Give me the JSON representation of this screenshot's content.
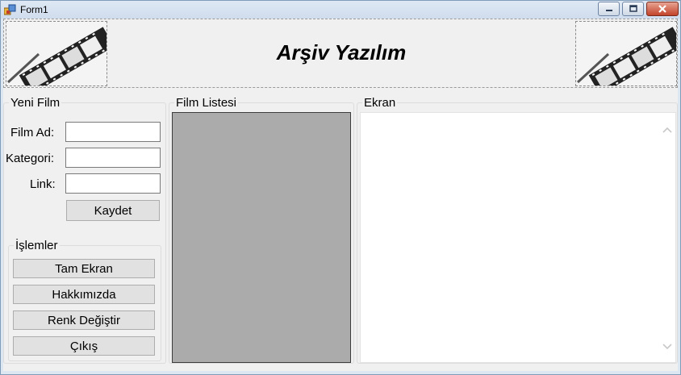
{
  "window": {
    "title": "Form1",
    "minimize_icon": "minimize-icon",
    "maximize_icon": "maximize-icon",
    "close_icon": "close-icon"
  },
  "banner": {
    "title": "Arşiv Yazılım",
    "left_image": "film-strip",
    "right_image": "film-strip"
  },
  "new_film": {
    "group_label": "Yeni Film",
    "name_label": "Film Ad:",
    "name_value": "",
    "category_label": "Kategori:",
    "category_value": "",
    "link_label": "Link:",
    "link_value": "",
    "save_label": "Kaydet"
  },
  "operations": {
    "group_label": "İşlemler",
    "buttons": [
      "Tam Ekran",
      "Hakkımızda",
      "Renk Değiştir",
      "Çıkış"
    ]
  },
  "film_list": {
    "group_label": "Film Listesi",
    "items": []
  },
  "screen": {
    "group_label": "Ekran"
  },
  "colors": {
    "list_bg": "#ababab",
    "screen_bg": "#ffffff",
    "form_bg": "#f0f0f0"
  }
}
